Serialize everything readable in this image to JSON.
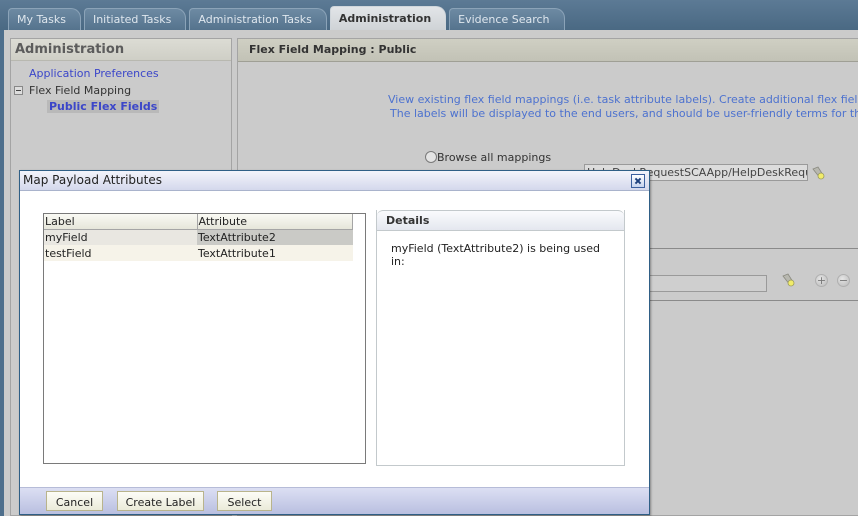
{
  "tabs": [
    {
      "label": "My Tasks",
      "active": false
    },
    {
      "label": "Initiated Tasks",
      "active": false
    },
    {
      "label": "Administration Tasks",
      "active": false
    },
    {
      "label": "Administration",
      "active": true
    },
    {
      "label": "Evidence Search",
      "active": false
    }
  ],
  "sidebar": {
    "title": "Administration",
    "items": [
      {
        "label": "Application Preferences"
      },
      {
        "label": "Flex Field Mapping"
      },
      {
        "label": "Public Flex Fields"
      }
    ]
  },
  "main": {
    "title": "Flex Field Mapping : Public",
    "info_line1": "View existing flex field mappings (i.e. task attribute labels). Create additional flex field labels and map these to tas",
    "info_line2": "The labels will be displayed to the end users, and should be user-friendly terms for the task attributes",
    "radio_browse": "Browse all mappings",
    "component_value": "HelpDeskRequestSCAApp/HelpDeskRequestC"
  },
  "dialog": {
    "title": "Map Payload Attributes",
    "table": {
      "headers": [
        "Label",
        "Attribute"
      ],
      "rows": [
        {
          "label": "myField",
          "attribute": "TextAttribute2"
        },
        {
          "label": "testField",
          "attribute": "TextAttribute1"
        }
      ]
    },
    "details": {
      "title": "Details",
      "text": "myField (TextAttribute2) is being used in:"
    },
    "buttons": {
      "cancel": "Cancel",
      "create_label": "Create Label",
      "select": "Select"
    }
  }
}
